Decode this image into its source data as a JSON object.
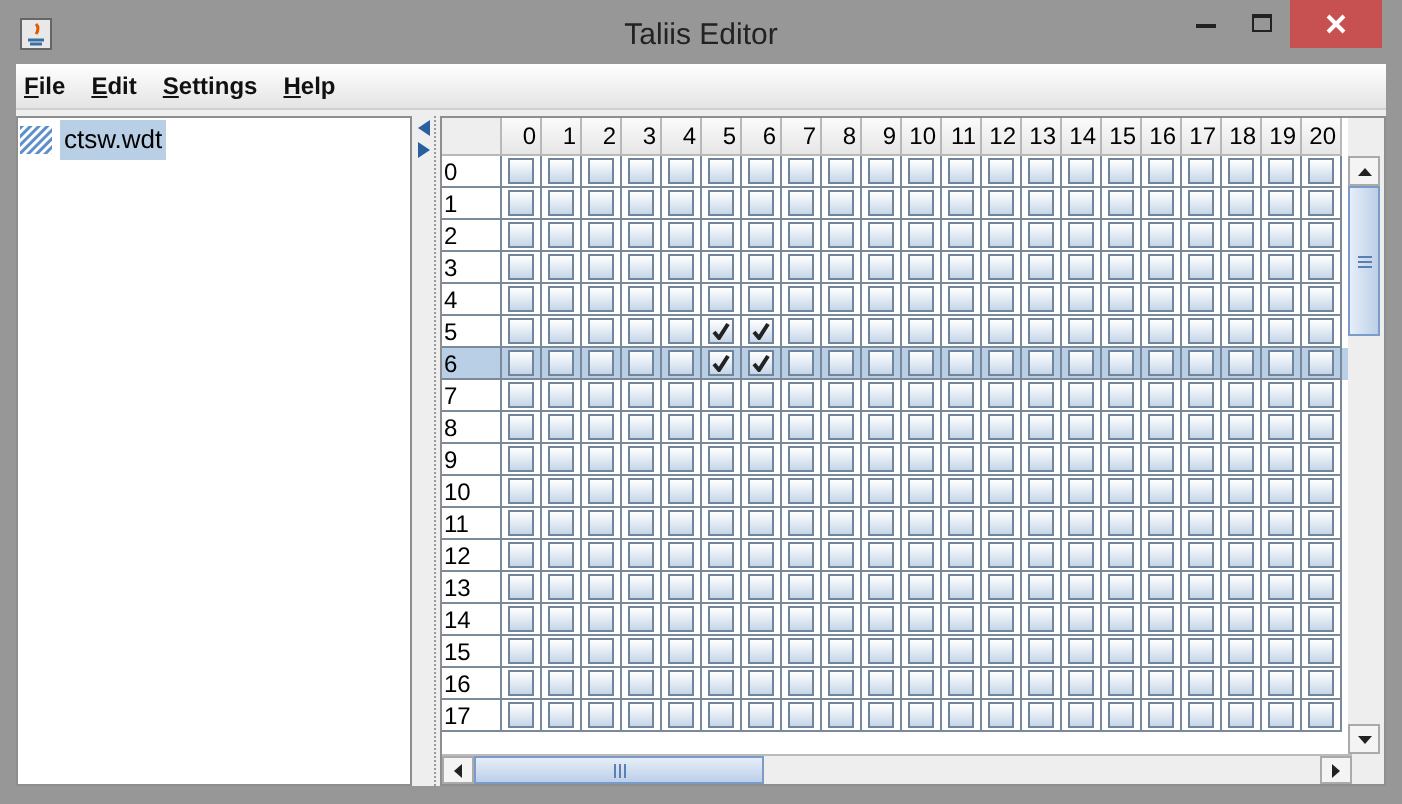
{
  "window": {
    "title": "Taliis Editor"
  },
  "menu": [
    {
      "label": "File"
    },
    {
      "label": "Edit"
    },
    {
      "label": "Settings"
    },
    {
      "label": "Help"
    }
  ],
  "files": [
    {
      "name": "ctsw.wdt",
      "selected": true
    }
  ],
  "table": {
    "columns": [
      "0",
      "1",
      "2",
      "3",
      "4",
      "5",
      "6",
      "7",
      "8",
      "9",
      "10",
      "11",
      "12",
      "13",
      "14",
      "15",
      "16",
      "17",
      "18",
      "19",
      "20"
    ],
    "rows": [
      {
        "label": "0",
        "selected": false,
        "cells": [
          false,
          false,
          false,
          false,
          false,
          false,
          false,
          false,
          false,
          false,
          false,
          false,
          false,
          false,
          false,
          false,
          false,
          false,
          false,
          false,
          false
        ]
      },
      {
        "label": "1",
        "selected": false,
        "cells": [
          false,
          false,
          false,
          false,
          false,
          false,
          false,
          false,
          false,
          false,
          false,
          false,
          false,
          false,
          false,
          false,
          false,
          false,
          false,
          false,
          false
        ]
      },
      {
        "label": "2",
        "selected": false,
        "cells": [
          false,
          false,
          false,
          false,
          false,
          false,
          false,
          false,
          false,
          false,
          false,
          false,
          false,
          false,
          false,
          false,
          false,
          false,
          false,
          false,
          false
        ]
      },
      {
        "label": "3",
        "selected": false,
        "cells": [
          false,
          false,
          false,
          false,
          false,
          false,
          false,
          false,
          false,
          false,
          false,
          false,
          false,
          false,
          false,
          false,
          false,
          false,
          false,
          false,
          false
        ]
      },
      {
        "label": "4",
        "selected": false,
        "cells": [
          false,
          false,
          false,
          false,
          false,
          false,
          false,
          false,
          false,
          false,
          false,
          false,
          false,
          false,
          false,
          false,
          false,
          false,
          false,
          false,
          false
        ]
      },
      {
        "label": "5",
        "selected": false,
        "cells": [
          false,
          false,
          false,
          false,
          false,
          true,
          true,
          false,
          false,
          false,
          false,
          false,
          false,
          false,
          false,
          false,
          false,
          false,
          false,
          false,
          false
        ]
      },
      {
        "label": "6",
        "selected": true,
        "cells": [
          false,
          false,
          false,
          false,
          false,
          true,
          true,
          false,
          false,
          false,
          false,
          false,
          false,
          false,
          false,
          false,
          false,
          false,
          false,
          false,
          false
        ]
      },
      {
        "label": "7",
        "selected": false,
        "cells": [
          false,
          false,
          false,
          false,
          false,
          false,
          false,
          false,
          false,
          false,
          false,
          false,
          false,
          false,
          false,
          false,
          false,
          false,
          false,
          false,
          false
        ]
      },
      {
        "label": "8",
        "selected": false,
        "cells": [
          false,
          false,
          false,
          false,
          false,
          false,
          false,
          false,
          false,
          false,
          false,
          false,
          false,
          false,
          false,
          false,
          false,
          false,
          false,
          false,
          false
        ]
      },
      {
        "label": "9",
        "selected": false,
        "cells": [
          false,
          false,
          false,
          false,
          false,
          false,
          false,
          false,
          false,
          false,
          false,
          false,
          false,
          false,
          false,
          false,
          false,
          false,
          false,
          false,
          false
        ]
      },
      {
        "label": "10",
        "selected": false,
        "cells": [
          false,
          false,
          false,
          false,
          false,
          false,
          false,
          false,
          false,
          false,
          false,
          false,
          false,
          false,
          false,
          false,
          false,
          false,
          false,
          false,
          false
        ]
      },
      {
        "label": "11",
        "selected": false,
        "cells": [
          false,
          false,
          false,
          false,
          false,
          false,
          false,
          false,
          false,
          false,
          false,
          false,
          false,
          false,
          false,
          false,
          false,
          false,
          false,
          false,
          false
        ]
      },
      {
        "label": "12",
        "selected": false,
        "cells": [
          false,
          false,
          false,
          false,
          false,
          false,
          false,
          false,
          false,
          false,
          false,
          false,
          false,
          false,
          false,
          false,
          false,
          false,
          false,
          false,
          false
        ]
      },
      {
        "label": "13",
        "selected": false,
        "cells": [
          false,
          false,
          false,
          false,
          false,
          false,
          false,
          false,
          false,
          false,
          false,
          false,
          false,
          false,
          false,
          false,
          false,
          false,
          false,
          false,
          false
        ]
      },
      {
        "label": "14",
        "selected": false,
        "cells": [
          false,
          false,
          false,
          false,
          false,
          false,
          false,
          false,
          false,
          false,
          false,
          false,
          false,
          false,
          false,
          false,
          false,
          false,
          false,
          false,
          false
        ]
      },
      {
        "label": "15",
        "selected": false,
        "cells": [
          false,
          false,
          false,
          false,
          false,
          false,
          false,
          false,
          false,
          false,
          false,
          false,
          false,
          false,
          false,
          false,
          false,
          false,
          false,
          false,
          false
        ]
      },
      {
        "label": "16",
        "selected": false,
        "cells": [
          false,
          false,
          false,
          false,
          false,
          false,
          false,
          false,
          false,
          false,
          false,
          false,
          false,
          false,
          false,
          false,
          false,
          false,
          false,
          false,
          false
        ]
      },
      {
        "label": "17",
        "selected": false,
        "cells": [
          false,
          false,
          false,
          false,
          false,
          false,
          false,
          false,
          false,
          false,
          false,
          false,
          false,
          false,
          false,
          false,
          false,
          false,
          false,
          false,
          false
        ]
      }
    ]
  }
}
